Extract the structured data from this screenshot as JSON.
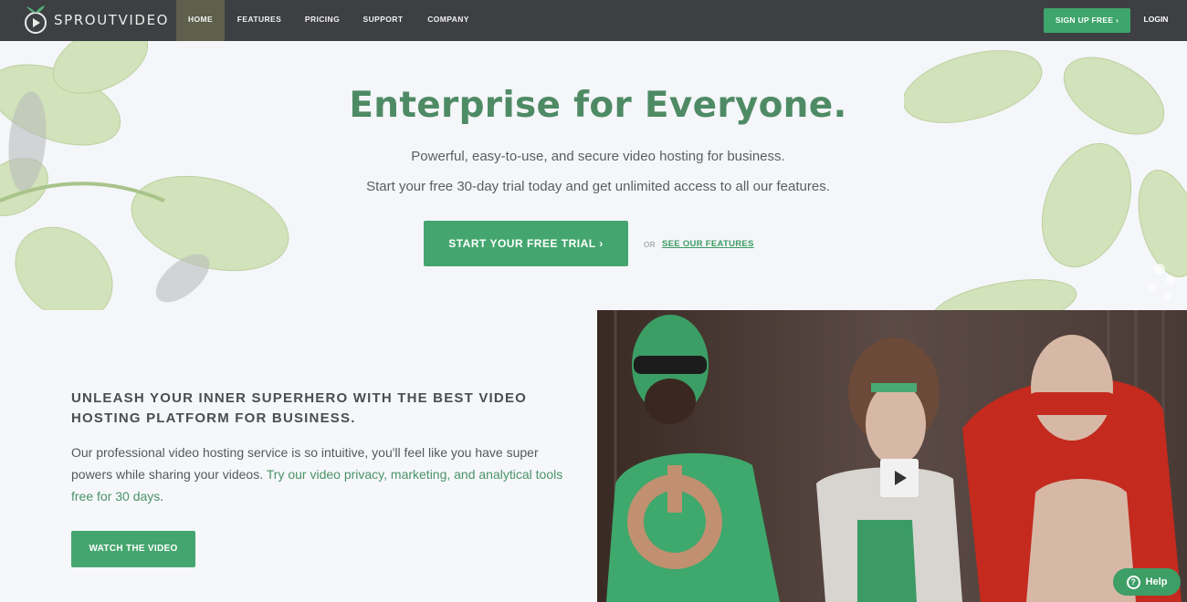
{
  "brand": {
    "name": "SPROUTVIDEO"
  },
  "nav": {
    "items": [
      "HOME",
      "FEATURES",
      "PRICING",
      "SUPPORT",
      "COMPANY"
    ],
    "active": "HOME",
    "signup_label": "SIGN UP FREE ›",
    "login_label": "LOGIN"
  },
  "hero": {
    "title": "Enterprise for Everyone.",
    "subtitle_1": "Powerful, easy-to-use, and secure video hosting for business.",
    "subtitle_2": "Start your free 30-day trial today and get unlimited access to all our features.",
    "cta_label": "START YOUR FREE TRIAL ›",
    "or_label": "OR",
    "features_link": "SEE OUR FEATURES"
  },
  "promo": {
    "heading_line_1": "UNLEASH YOUR INNER SUPERHERO WITH THE BEST VIDEO",
    "heading_line_2": "HOSTING PLATFORM FOR BUSINESS.",
    "text_plain": "Our professional video hosting service is so intuitive, you'll feel like you have super powers while sharing your videos. ",
    "text_link": "Try our video privacy, marketing, and analytical tools free for 30 days",
    "text_end": ".",
    "watch_label": "WATCH THE VIDEO"
  },
  "help": {
    "label": "Help"
  },
  "colors": {
    "nav_bg": "#3d3f42",
    "accent_green": "#44a66e",
    "title_green": "#4e8b65"
  }
}
